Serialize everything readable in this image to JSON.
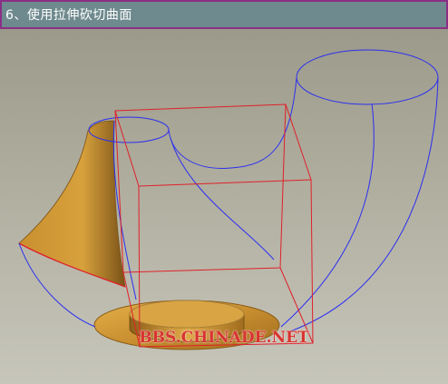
{
  "window": {
    "title": "6、使用拉伸砍切曲面"
  },
  "watermark": "BBS.CHINADE.NET",
  "colors": {
    "title_bar_bg": "#6f8a8e",
    "title_bar_border": "#8a2f86",
    "wireframe_blue": "#2b2ff0",
    "box_red": "#e0202a",
    "surface_gold": "#c98f30"
  },
  "scene": {
    "objects": [
      {
        "name": "swept-pipe-wireframe",
        "style": "blue wireframe"
      },
      {
        "name": "trimmed-flared-surface",
        "style": "shaded gold"
      },
      {
        "name": "extrusion-cut-box",
        "style": "red wireframe"
      },
      {
        "name": "base-disk",
        "style": "shaded gold"
      }
    ]
  }
}
